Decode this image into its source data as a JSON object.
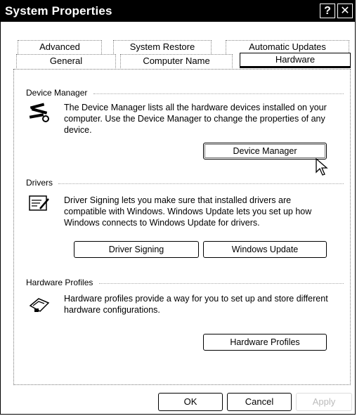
{
  "window": {
    "title": "System Properties"
  },
  "titlebar": {
    "help_symbol": "?",
    "close_symbol": "✕"
  },
  "tabs": {
    "row1": [
      "Advanced",
      "System Restore",
      "Automatic Updates"
    ],
    "row2": [
      "General",
      "Computer Name",
      "Hardware"
    ],
    "active": "Hardware"
  },
  "device_manager": {
    "heading": "Device Manager",
    "description": "The Device Manager lists all the hardware devices installed on your computer. Use the Device Manager to change the properties of any device.",
    "button": "Device Manager"
  },
  "drivers": {
    "heading": "Drivers",
    "description": "Driver Signing lets you make sure that installed drivers are compatible with Windows. Windows Update lets you set up how Windows connects to Windows Update for drivers.",
    "signing_button": "Driver Signing",
    "update_button": "Windows Update"
  },
  "hardware_profiles": {
    "heading": "Hardware Profiles",
    "description": "Hardware profiles provide a way for you to set up and store different hardware configurations.",
    "button": "Hardware Profiles"
  },
  "footer": {
    "ok": "OK",
    "cancel": "Cancel",
    "apply": "Apply"
  }
}
